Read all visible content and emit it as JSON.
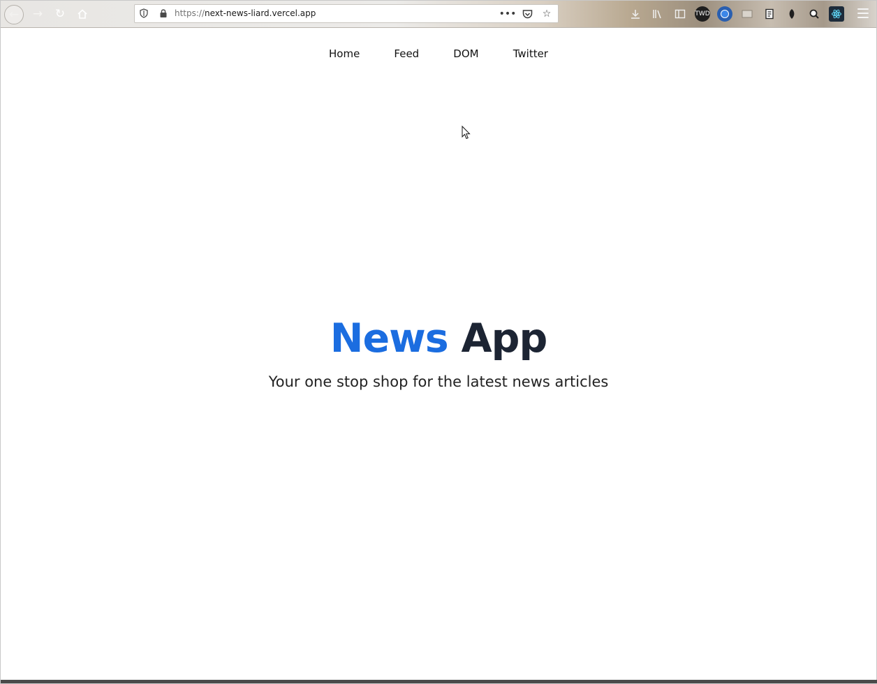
{
  "browser": {
    "url_protocol": "https://",
    "url_host": "next-news-liard.vercel.app",
    "icons": {
      "back": "back-arrow-icon",
      "forward": "forward-arrow-icon",
      "reload": "reload-icon",
      "home": "home-icon",
      "site_info": "shield-icon",
      "secure": "lock-icon",
      "page_actions": "more-dots-icon",
      "pocket": "pocket-icon",
      "bookmark": "star-icon",
      "downloads": "download-icon",
      "library": "library-icon",
      "sidebar": "sidebar-icon",
      "menu": "hamburger-menu-icon"
    },
    "extension_badge_text": "TWD"
  },
  "site_nav": {
    "links": [
      {
        "label": "Home"
      },
      {
        "label": "Feed"
      },
      {
        "label": "DOM"
      },
      {
        "label": "Twitter"
      }
    ]
  },
  "hero": {
    "title_accent": "News",
    "title_rest": "App",
    "subtitle": "Your one stop shop for the latest news articles"
  },
  "colors": {
    "accent": "#1b6de0",
    "title_dark": "#1c2433",
    "text": "#222222",
    "background": "#ffffff"
  }
}
